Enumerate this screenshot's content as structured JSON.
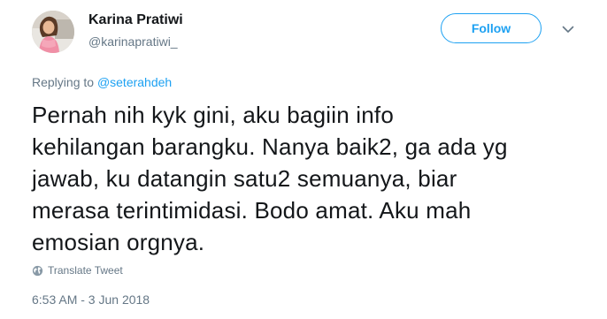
{
  "author": {
    "name": "Karina Pratiwi",
    "handle": "@karinapratiwi_"
  },
  "follow_label": "Follow",
  "icons": {
    "more": "chevron-down-icon",
    "translate": "globe-icon"
  },
  "reply": {
    "prefix": "Replying to",
    "mention": "@seterahdeh"
  },
  "tweet_lines": [
    "Pernah nih kyk gini, aku bagiin info",
    "kehilangan barangku. Nanya baik2, ga ada yg",
    "jawab, ku datangin satu2 semuanya, biar",
    "merasa terintimidasi. Bodo amat. Aku mah",
    "emosian orgnya."
  ],
  "translate_label": "Translate Tweet",
  "timestamp": "6:53 AM - 3 Jun 2018",
  "colors": {
    "accent": "#1da1f2",
    "secondary_text": "#657786",
    "primary_text": "#14171a"
  }
}
